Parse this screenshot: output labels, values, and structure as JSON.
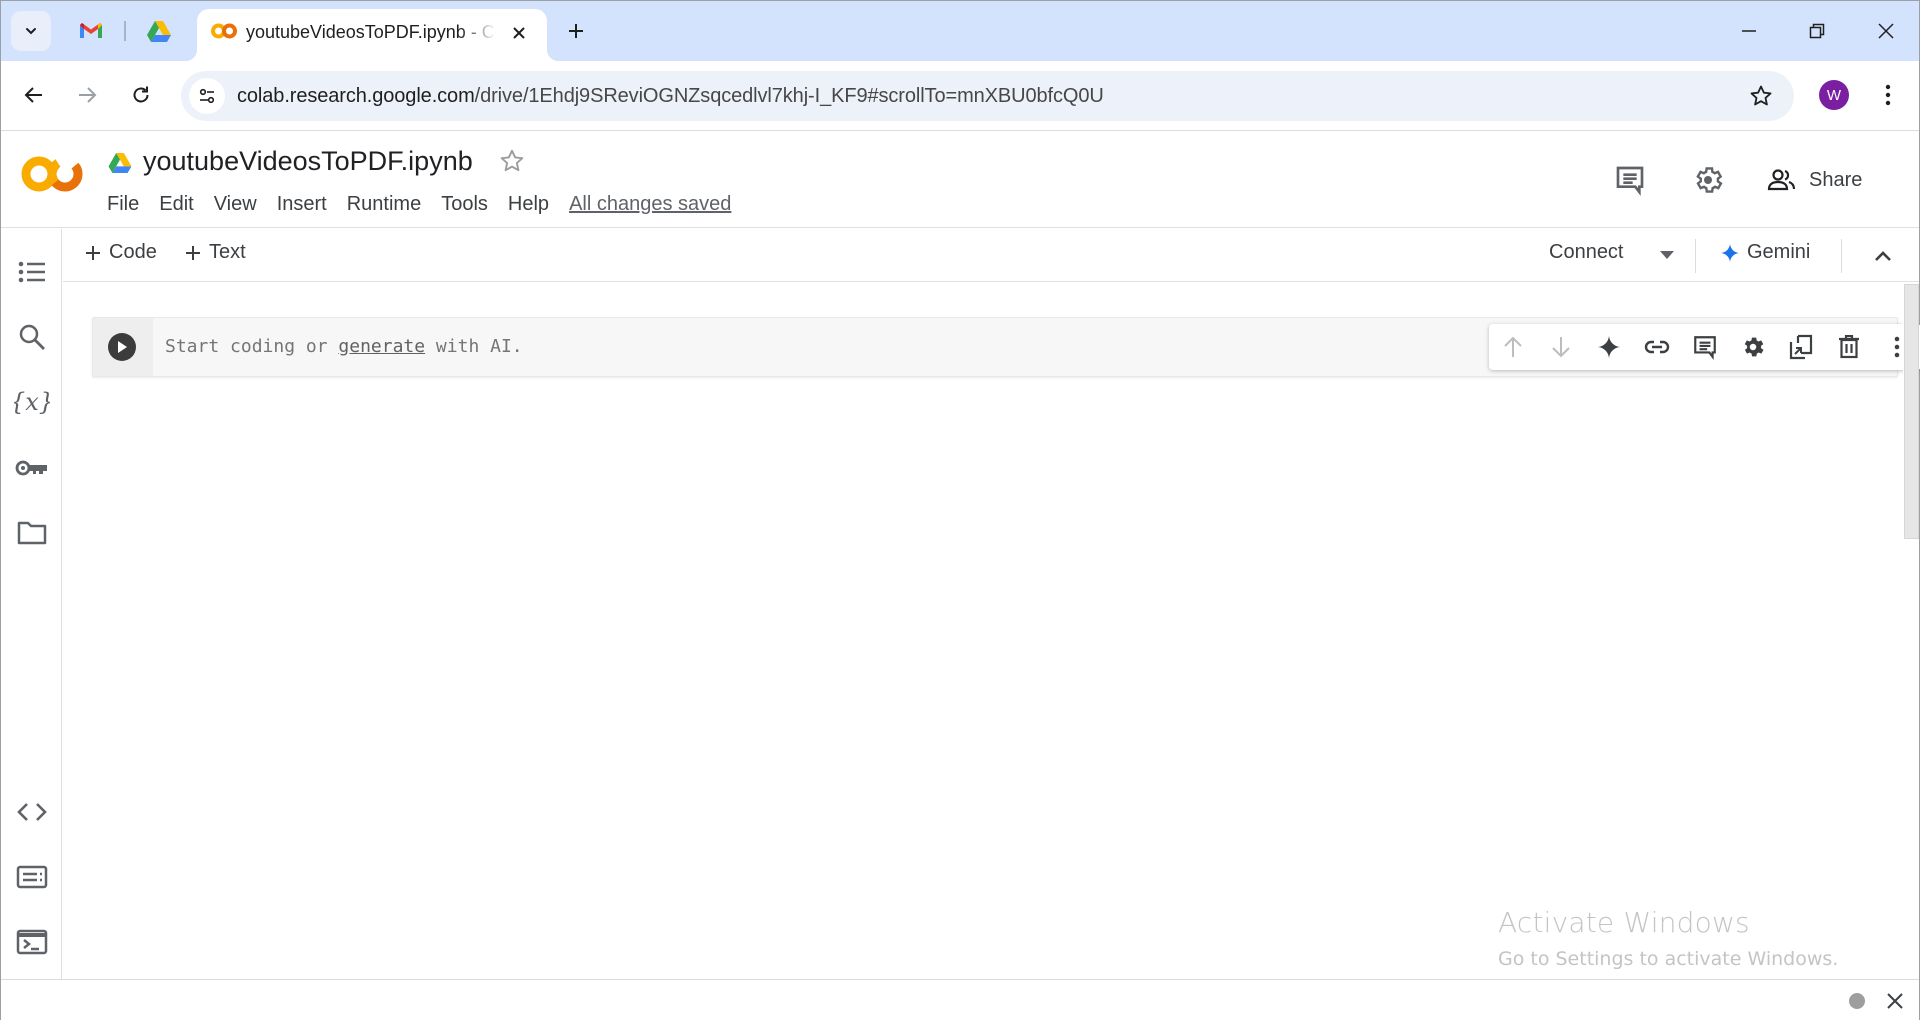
{
  "browser": {
    "tabs": [
      {
        "title": "youtubeVideosToPDF.ipynb - Colab",
        "active": true,
        "favicon": "colab-icon"
      }
    ],
    "pinned_tabs": [
      {
        "name": "Gmail",
        "icon": "gmail-icon"
      },
      {
        "name": "Google Drive",
        "icon": "drive-icon"
      }
    ],
    "url": {
      "domain": "colab.research.google.com",
      "path": "/drive/1Ehdj9SReviOGNZsqcedlvl7khj-I_KF9#scrollTo=mnXBU0bfcQ0U"
    },
    "profile_initial": "W",
    "profile_color": "#7b1fa2"
  },
  "colab": {
    "notebook_title": "youtubeVideosToPDF.ipynb",
    "menu": [
      "File",
      "Edit",
      "View",
      "Insert",
      "Runtime",
      "Tools",
      "Help"
    ],
    "save_status": "All changes saved",
    "share_label": "Share",
    "add_code_label": "Code",
    "add_text_label": "Text",
    "connect_label": "Connect",
    "gemini_label": "Gemini",
    "cell": {
      "placeholder_prefix": "Start coding or ",
      "placeholder_link": "generate",
      "placeholder_suffix": " with AI."
    },
    "sidebar_top": [
      "table-of-contents",
      "find-and-replace",
      "variables",
      "secrets",
      "files"
    ],
    "sidebar_bottom": [
      "code-snippets",
      "command-palette",
      "terminal"
    ],
    "cell_actions": [
      "move-cell-up",
      "move-cell-down",
      "gemini-spark",
      "link-to-cell",
      "add-comment",
      "cell-settings",
      "mirror-cell",
      "delete-cell",
      "more-options"
    ]
  },
  "watermark": {
    "line1": "Activate Windows",
    "line2": "Go to Settings to activate Windows."
  },
  "colors": {
    "tabstrip": "#d3e3fd",
    "omnibox": "#edf2fa",
    "colab_orange": "#f9ab00",
    "colab_dark_orange": "#e8710a",
    "gemini_blue": "#1a73e8"
  }
}
